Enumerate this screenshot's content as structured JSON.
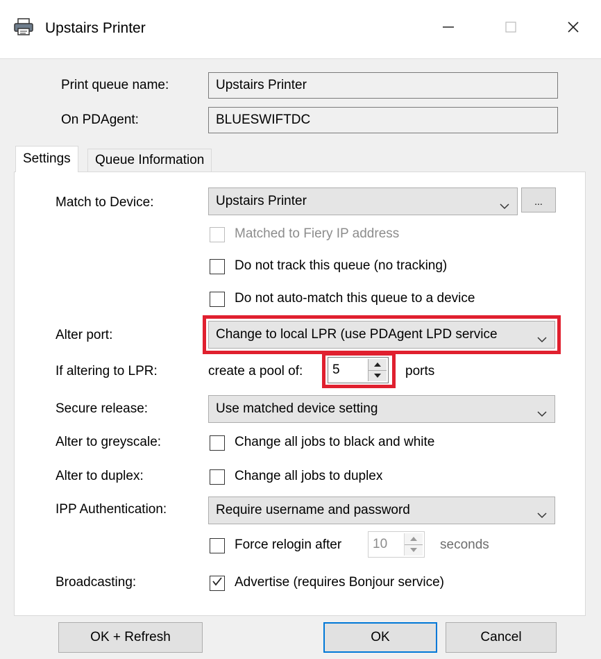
{
  "window": {
    "title": "Upstairs Printer",
    "minimize_icon": "minimize-icon",
    "maximize_icon": "maximize-icon",
    "close_icon": "close-icon",
    "app_icon": "printer-icon"
  },
  "header": {
    "print_queue_label": "Print queue name:",
    "print_queue_value": "Upstairs Printer",
    "pdagent_label": "On PDAgent:",
    "pdagent_value": "BLUESWIFTDC"
  },
  "tabs": [
    {
      "label": "Settings",
      "active": true
    },
    {
      "label": "Queue Information",
      "active": false
    }
  ],
  "settings": {
    "match_device_label": "Match to Device:",
    "match_device_value": "Upstairs Printer",
    "browse_label": "...",
    "matched_fiery_label": "Matched to Fiery IP address",
    "no_track_label": "Do not track this queue (no tracking)",
    "no_automatch_label": "Do not auto-match this queue to a device",
    "alter_port_label": "Alter port:",
    "alter_port_value": "Change to local LPR (use PDAgent LPD service",
    "lpr_label": "If altering to LPR:",
    "pool_prefix": "create a pool of:",
    "pool_value": "5",
    "pool_suffix": "ports",
    "secure_release_label": "Secure release:",
    "secure_release_value": "Use matched device setting",
    "greyscale_label": "Alter to greyscale:",
    "greyscale_checkbox": "Change all jobs to black and white",
    "duplex_label": "Alter to duplex:",
    "duplex_checkbox": "Change all jobs to duplex",
    "ipp_label": "IPP Authentication:",
    "ipp_value": "Require username and password",
    "relogin_label": "Force relogin after",
    "relogin_value": "10",
    "relogin_suffix": "seconds",
    "broadcasting_label": "Broadcasting:",
    "advertise_label": "Advertise (requires Bonjour service)",
    "advertise_checked": true
  },
  "buttons": {
    "ok_refresh": "OK + Refresh",
    "ok": "OK",
    "cancel": "Cancel"
  },
  "colors": {
    "highlight": "#e0202f",
    "default_button_border": "#0078d7"
  }
}
